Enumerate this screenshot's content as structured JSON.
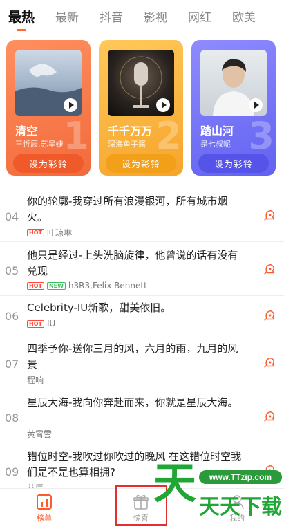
{
  "tabs": [
    "最热",
    "最新",
    "抖音",
    "影视",
    "网红",
    "欧美"
  ],
  "active_tab": "最热",
  "cards": [
    {
      "rank": "1",
      "title": "清空",
      "artist": "王忻辰,苏星婕",
      "button": "设为彩铃",
      "color": "#f26a3b"
    },
    {
      "rank": "2",
      "title": "千千万万",
      "artist": "深海鱼子酱",
      "button": "设为彩铃",
      "color": "#f6a42b"
    },
    {
      "rank": "3",
      "title": "踏山河",
      "artist": "是七叔呢",
      "button": "设为彩铃",
      "color": "#6162f0"
    }
  ],
  "songs": [
    {
      "num": "04",
      "title": "你的轮廓-我穿过所有浪漫银河，所有城市烟火。",
      "badges": [
        "HOT"
      ],
      "artist": "叶琼琳"
    },
    {
      "num": "05",
      "title": "他只是经过-上头洗脑旋律，他曾说的话有没有兑现",
      "badges": [
        "HOT",
        "NEW"
      ],
      "artist": "h3R3,Felix Bennett"
    },
    {
      "num": "06",
      "title": "Celebrity-IU新歌，甜美依旧。",
      "badges": [
        "HOT"
      ],
      "artist": "IU"
    },
    {
      "num": "07",
      "title": "四季予你-送你三月的风，六月的雨，九月的风景",
      "badges": [],
      "artist": "程响"
    },
    {
      "num": "08",
      "title": "星辰大海-我向你奔赴而来，你就是星辰大海。",
      "badges": [],
      "artist": "黄霄雲"
    },
    {
      "num": "09",
      "title": "错位时空-我吹过你吹过的晚风 在这错位时空我们是不是也算相拥?",
      "badges": [],
      "artist": "艾辰"
    }
  ],
  "bottom_nav": [
    {
      "label": "榜单",
      "icon": "chart-icon",
      "active": true
    },
    {
      "label": "惊喜",
      "icon": "gift-icon",
      "active": false
    },
    {
      "label": "我的",
      "icon": "user-icon",
      "active": false
    }
  ],
  "watermark": {
    "url": "www.TTzip.com",
    "text": "天天下载",
    "glyph": "天"
  },
  "colors": {
    "accent": "#ff5a2a",
    "hot": "#ff4a3a",
    "new": "#3bbf5a"
  }
}
